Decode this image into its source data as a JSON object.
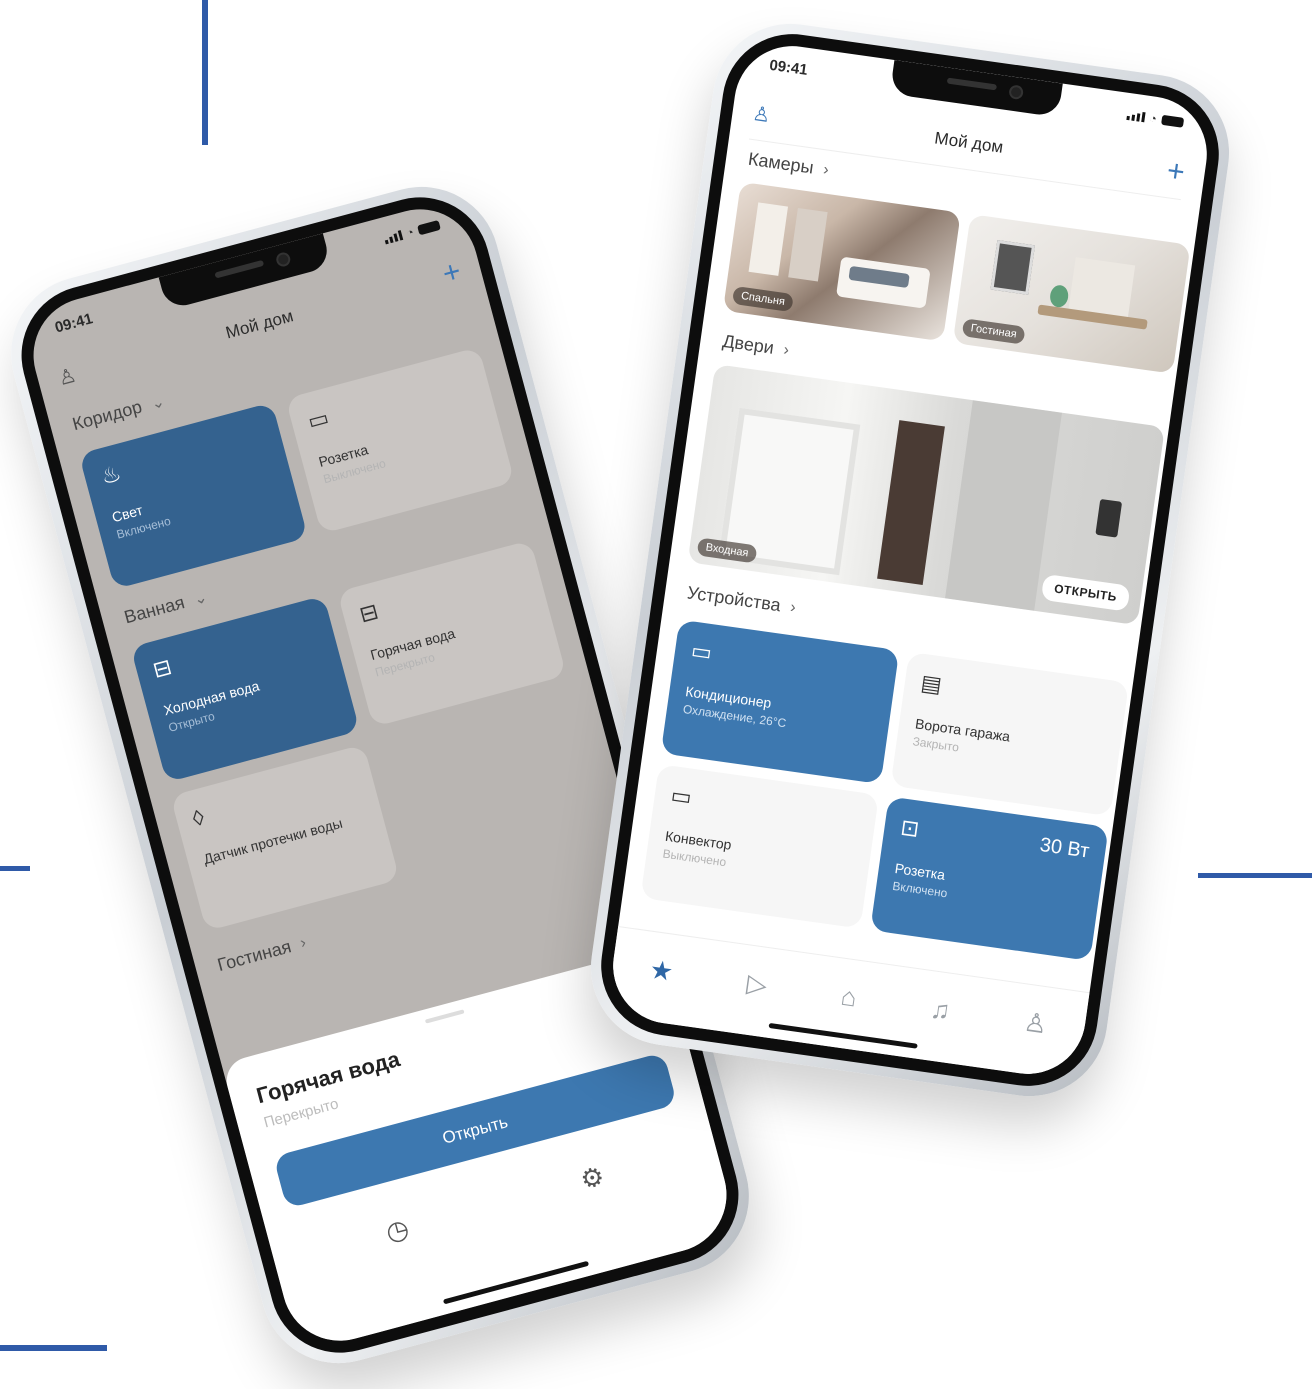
{
  "colors": {
    "accent": "#3d78b0",
    "decor_line": "#2f5aa8"
  },
  "left_phone": {
    "status_time": "09:41",
    "title": "Мой дом",
    "sections": {
      "corridor": "Коридор",
      "bathroom": "Ванная",
      "living": "Гостиная"
    },
    "tiles": {
      "light": {
        "name": "Свет",
        "state": "Включено",
        "icon": "chandelier-icon"
      },
      "socket": {
        "name": "Розетка",
        "state": "Выключено",
        "icon": "socket-icon"
      },
      "cold": {
        "name": "Холодная вода",
        "state": "Открыто",
        "icon": "valve-icon"
      },
      "hot": {
        "name": "Горячая вода",
        "state": "Перекрыто",
        "icon": "valve-icon"
      },
      "leak": {
        "name": "Датчик протечки воды",
        "icon": "drop-icon"
      }
    },
    "sheet": {
      "title": "Горячая вода",
      "state": "Перекрыто",
      "button": "Открыть",
      "icons": [
        "clock-icon",
        "gear-icon"
      ]
    }
  },
  "right_phone": {
    "status_time": "09:41",
    "title": "Мой дом",
    "sections": {
      "cameras": "Камеры",
      "doors": "Двери",
      "devices": "Устройства"
    },
    "cameras": [
      {
        "label": "Спальня"
      },
      {
        "label": "Гостиная"
      }
    ],
    "door": {
      "label": "Входная",
      "button": "ОТКРЫТЬ"
    },
    "tiles": {
      "ac": {
        "name": "Кондиционер",
        "state": "Охлаждение, 26°C",
        "icon": "ac-icon"
      },
      "garage": {
        "name": "Ворота гаража",
        "state": "Закрыто",
        "icon": "garage-icon"
      },
      "heater": {
        "name": "Конвектор",
        "state": "Выключено",
        "icon": "heater-icon"
      },
      "socket": {
        "name": "Розетка",
        "state": "Включено",
        "power": "30 Вт",
        "icon": "socket-icon"
      }
    },
    "tabbar": [
      "star-icon",
      "play-icon",
      "home-icon",
      "bell-icon",
      "user-icon"
    ]
  }
}
